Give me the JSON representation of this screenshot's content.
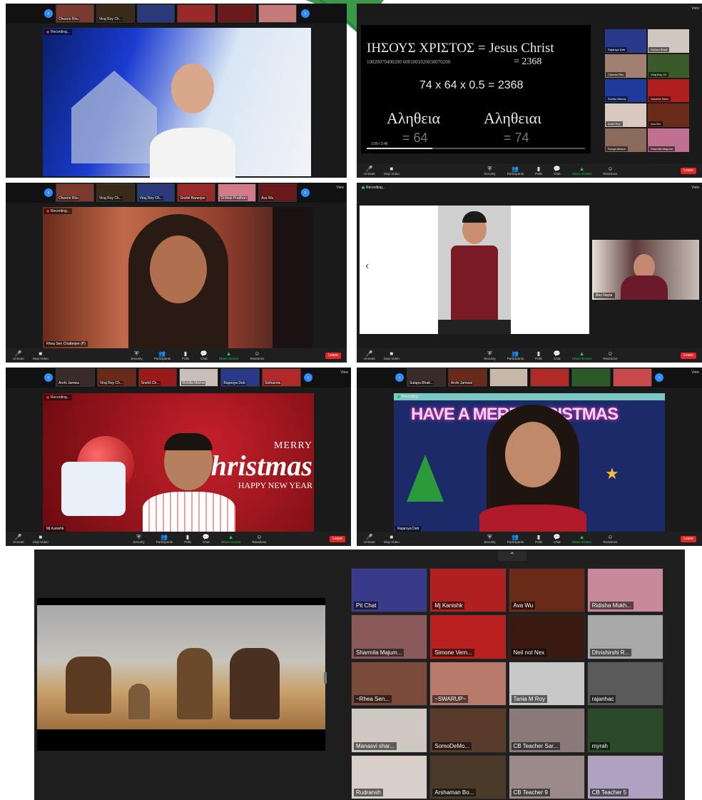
{
  "colors": {
    "zoom_blue": "#2d8cff",
    "leave_red": "#e02828",
    "share_green": "#22c55e",
    "leaf_green": "#3a9a4a"
  },
  "toolbar": {
    "unmute": "Unmute",
    "stop_video": "Stop Video",
    "security": "Security",
    "participants": "Participants",
    "polls": "Polls",
    "chat": "Chat",
    "share_screen": "Share Screen",
    "reactions": "Reactions",
    "leave": "Leave"
  },
  "recording": "Recording...",
  "view": "View",
  "panel1": {
    "thumbs": [
      "Cheerio Riru",
      "Viraj Roy Ch...",
      "",
      "",
      "",
      ""
    ]
  },
  "panel2": {
    "greek_line": "ΙΗΣΟΥΣ ΧΡΙΣΤΟΣ = Jesus Christ",
    "digits": "10820070400200 6001001020030070200",
    "sum": "= 2368",
    "formula": "74 x 64 x 0.5 = 2368",
    "word1": "Αληθεια",
    "val1": "= 64",
    "word2": "Αληθειαι",
    "val2": "= 74",
    "time": "1:09 / 3:46",
    "side_names": [
      "Rajarsya Deb",
      "Soham Bhatt",
      "Cheerio Riru",
      "Viraj Roy Ch",
      "Rohilla Mishra",
      "Sasmita Sahu",
      "Arohi Roy",
      "Ava Wu",
      "Rutuja Mishra",
      "Sharmila Majumd"
    ]
  },
  "panel3": {
    "thumbs": [
      "Cheerio Riru",
      "Viraj Roy Ch...",
      "Viraj Roy Ch...",
      "Snehil Banerjee",
      "Ordinal Pradhan",
      "Ava Wu"
    ],
    "name": "Rhea Sen Chatterjee (P)"
  },
  "panel4": {
    "name": "Anu Nayar"
  },
  "panel5": {
    "thumbs": [
      "Arohi Jamwa",
      "Viraj Roy Ch...",
      "Snehil Ch...",
      "Rohilla Mishra",
      "Rajarsya Deb",
      "Sinhannie"
    ],
    "name": "Mj Kanishk",
    "merry": "MERRY",
    "christmas": "Christmas",
    "happy": "HAPPY NEW YEAR"
  },
  "panel6": {
    "thumbs": [
      "Sutapa Bhatt...",
      "Arohi Jamwal",
      "",
      "",
      "",
      ""
    ],
    "name": "Rajarsya Deb",
    "banner": "HAVE A MERRY CRISTMAS"
  },
  "panel7": {
    "tiles": [
      "Pit Chat",
      "Mj Kanishk",
      "Ava Wu",
      "Ridisha Mukh...",
      "Sharmila Majum...",
      "Simone Vern...",
      "Neil not Nex",
      "Dhrishirshi R...",
      "~Rhea Sen...",
      "~SWARUP~",
      "Tania M Roy",
      "rajanhac",
      "Manasvi shar...",
      "SomoDeMo...",
      "CB Teacher Sar...",
      "myrah",
      "Rudransh",
      "Arshaman Bo...",
      "CB Teacher 9",
      "CB Teacher 5"
    ]
  }
}
